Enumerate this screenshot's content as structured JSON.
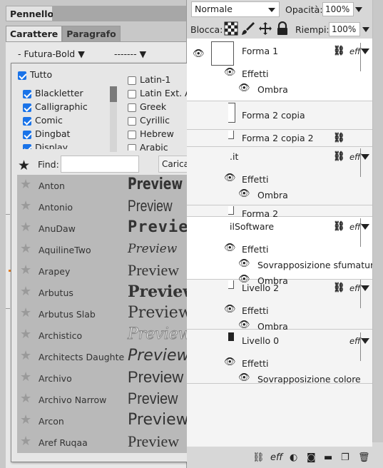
{
  "left_panel": {
    "title": "Pennello",
    "tabs": [
      "Carattere",
      "Paragrafo"
    ],
    "font_value": "- Futura-Bold ▼",
    "size_value": "------- ▼"
  },
  "font_popup": {
    "all_label": "Tutto",
    "categories_left": [
      {
        "label": "Blackletter",
        "checked": true
      },
      {
        "label": "Calligraphic",
        "checked": true
      },
      {
        "label": "Comic",
        "checked": true
      },
      {
        "label": "Dingbat",
        "checked": true
      },
      {
        "label": "Display",
        "checked": true
      }
    ],
    "categories_right": [
      {
        "label": "Latin-1",
        "checked": false
      },
      {
        "label": "Latin Ext. A",
        "checked": false
      },
      {
        "label": "Greek",
        "checked": false
      },
      {
        "label": "Cyrillic",
        "checked": false
      },
      {
        "label": "Hebrew",
        "checked": false
      },
      {
        "label": "Arabic",
        "checked": false
      }
    ],
    "find_label": "Find:",
    "find_value": "",
    "load_button": "Carica Font",
    "preview_text": "Preview",
    "fonts": [
      "Anton",
      "Antonio",
      "AnuDaw",
      "AquilineTwo",
      "Arapey",
      "Arbutus",
      "Arbutus Slab",
      "Archistico",
      "Architects Daughter",
      "Archivo",
      "Archivo Narrow",
      "Arcon",
      "Aref Ruqaa"
    ]
  },
  "layers_panel": {
    "blend_mode": "Normale",
    "opacity_label": "Opacità:",
    "opacity_value": "100%",
    "lock_label": "Blocca:",
    "fill_label": "Riempi:",
    "fill_value": "100%",
    "fx_label": "eff",
    "layers": [
      {
        "name": "Forma 1",
        "effects_label": "Effetti",
        "effects": [
          "Ombra"
        ]
      },
      {
        "name": "Forma 2 copia",
        "effects_label": "",
        "effects": []
      },
      {
        "name": "Forma 2 copia 2",
        "effects_label": "",
        "effects": []
      },
      {
        "name": ".it",
        "effects_label": "Effetti",
        "effects": [
          "Ombra"
        ]
      },
      {
        "name": "Forma 2",
        "effects_label": "",
        "effects": []
      },
      {
        "name": "ilSoftware",
        "effects_label": "Effetti",
        "effects": [
          "Sovrapposizione sfumatura",
          "Ombra"
        ]
      },
      {
        "name": "Livello 2",
        "effects_label": "Effetti",
        "effects": [
          "Ombra"
        ]
      },
      {
        "name": "Livello 0",
        "effects_label": "Effetti",
        "effects": [
          "Sovrapposizione colore"
        ]
      }
    ],
    "footer_fx": "eff"
  }
}
